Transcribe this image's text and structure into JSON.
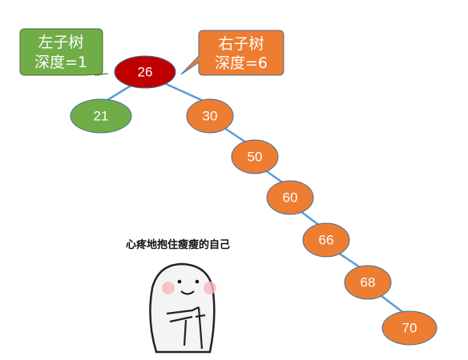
{
  "tree": {
    "root": {
      "value": "26",
      "color": "#c00000"
    },
    "left": [
      {
        "value": "21",
        "color": "#70ad47"
      }
    ],
    "right_chain": [
      {
        "value": "30"
      },
      {
        "value": "50"
      },
      {
        "value": "60"
      },
      {
        "value": "66"
      },
      {
        "value": "68"
      },
      {
        "value": "70"
      }
    ],
    "right_color": "#ed7d31",
    "edge_color": "#5b9bd5"
  },
  "callouts": {
    "left": {
      "line1": "左子树",
      "line2": "深度=1",
      "color": "#70ad47"
    },
    "right": {
      "line1": "右子树",
      "line2": "深度=6",
      "color": "#ed7d31"
    }
  },
  "meme": {
    "caption": "心疼地抱住瘦瘦的自己"
  }
}
